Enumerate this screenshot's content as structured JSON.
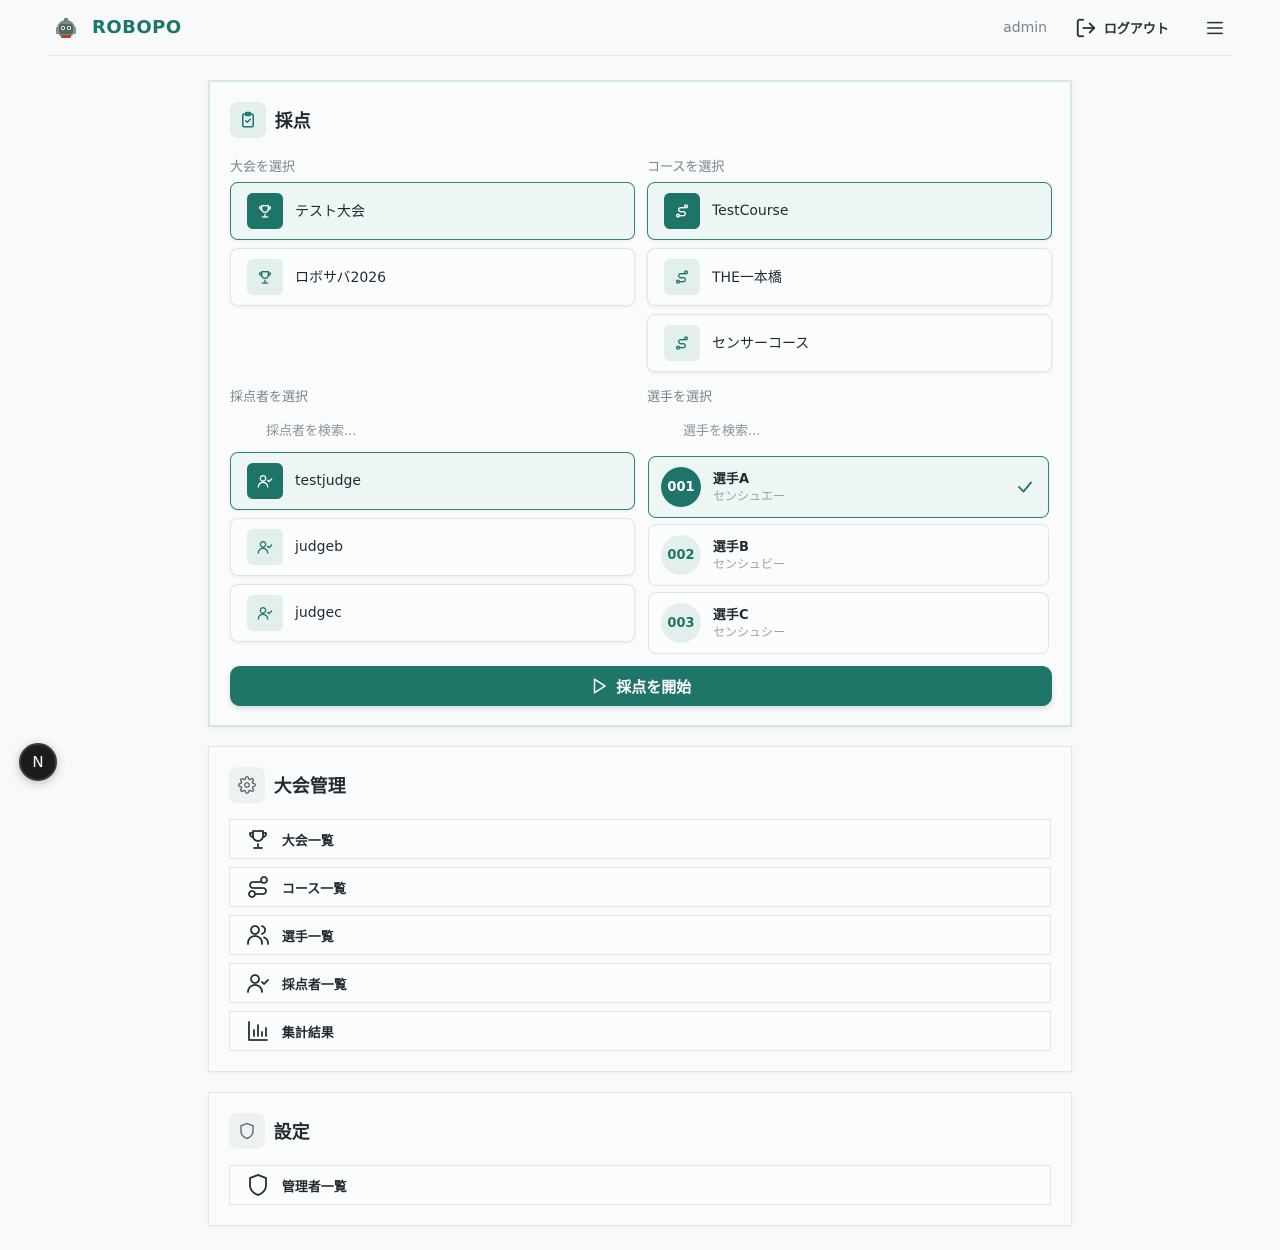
{
  "header": {
    "app_name": "ROBOPO",
    "user": "admin",
    "logout_label": "ログアウト"
  },
  "scoring": {
    "title": "採点",
    "tournament_label": "大会を選択",
    "course_label": "コースを選択",
    "judge_label": "採点者を選択",
    "player_label": "選手を選択",
    "judge_search_placeholder": "採点者を検索...",
    "player_search_placeholder": "選手を検索...",
    "tournaments": [
      {
        "name": "テスト大会",
        "selected": true
      },
      {
        "name": "ロボサバ2026",
        "selected": false
      }
    ],
    "courses": [
      {
        "name": "TestCourse",
        "selected": true
      },
      {
        "name": "THE一本橋",
        "selected": false
      },
      {
        "name": "センサーコース",
        "selected": false
      }
    ],
    "judges": [
      {
        "name": "testjudge",
        "selected": true
      },
      {
        "name": "judgeb",
        "selected": false
      },
      {
        "name": "judgec",
        "selected": false
      }
    ],
    "players": [
      {
        "number": "001",
        "name": "選手A",
        "kana": "センシュエー",
        "selected": true
      },
      {
        "number": "002",
        "name": "選手B",
        "kana": "センシュビー",
        "selected": false
      },
      {
        "number": "003",
        "name": "選手C",
        "kana": "センシュシー",
        "selected": false
      }
    ],
    "start_label": "採点を開始"
  },
  "management": {
    "title": "大会管理",
    "items": [
      {
        "label": "大会一覧",
        "icon": "trophy-icon"
      },
      {
        "label": "コース一覧",
        "icon": "route-icon"
      },
      {
        "label": "選手一覧",
        "icon": "users-icon"
      },
      {
        "label": "採点者一覧",
        "icon": "user-check-icon"
      },
      {
        "label": "集計結果",
        "icon": "bar-chart-icon"
      }
    ]
  },
  "settings": {
    "title": "設定",
    "items": [
      {
        "label": "管理者一覧",
        "icon": "shield-icon"
      }
    ]
  },
  "badge": {
    "letter": "N"
  },
  "colors": {
    "brand": "#1c7769",
    "selected_border": "#2a8576",
    "button_bg": "#1f7668"
  }
}
